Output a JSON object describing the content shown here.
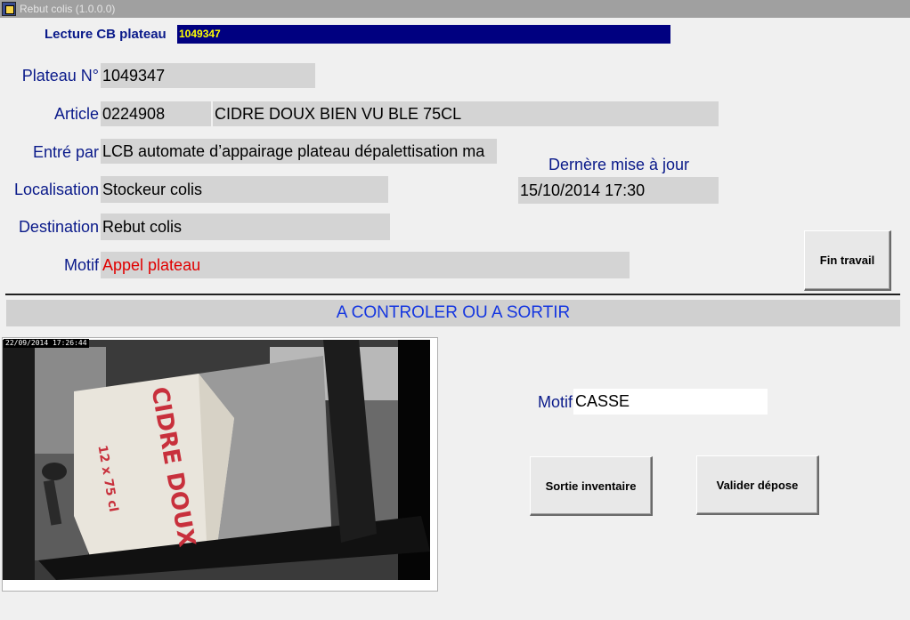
{
  "window": {
    "title": "Rebut colis (1.0.0.0)",
    "icon": "app-icon"
  },
  "barcode": {
    "label": "Lecture CB plateau",
    "value": "1049347"
  },
  "fields": {
    "plateau": {
      "label": "Plateau N°",
      "value": "1049347"
    },
    "article": {
      "label": "Article",
      "code": "0224908",
      "description": "CIDRE DOUX BIEN VU BLE 75CL"
    },
    "entre_par": {
      "label": "Entré par",
      "value": "LCB automate d’appairage plateau dépalettisation ma"
    },
    "localisation": {
      "label": "Localisation",
      "value": "Stockeur colis"
    },
    "destination": {
      "label": "Destination",
      "value": "Rebut colis"
    },
    "motif": {
      "label": "Motif",
      "value": "Appel plateau"
    }
  },
  "update": {
    "label": "Dernère mise à jour",
    "value": "15/10/2014 17:30"
  },
  "buttons": {
    "fin_travail": "Fin travail",
    "sortie_inventaire": "Sortie inventaire",
    "valider_depose": "Valider dépose"
  },
  "banner": "A CONTROLER OU A SORTIR",
  "camera": {
    "timestamp": "22/09/2014  17:26:44",
    "box_text": "CIDRE DOUX",
    "box_subtext": "12 x 75 cl"
  },
  "motif_check": {
    "label": "Motif",
    "value": "CASSE"
  },
  "colors": {
    "label": "#0a1a8a",
    "field_bg": "#d4d4d4",
    "barcode_bg": "#000080",
    "barcode_text": "#ffff00",
    "banner_text": "#1436e0",
    "motif_value": "#e00000"
  }
}
